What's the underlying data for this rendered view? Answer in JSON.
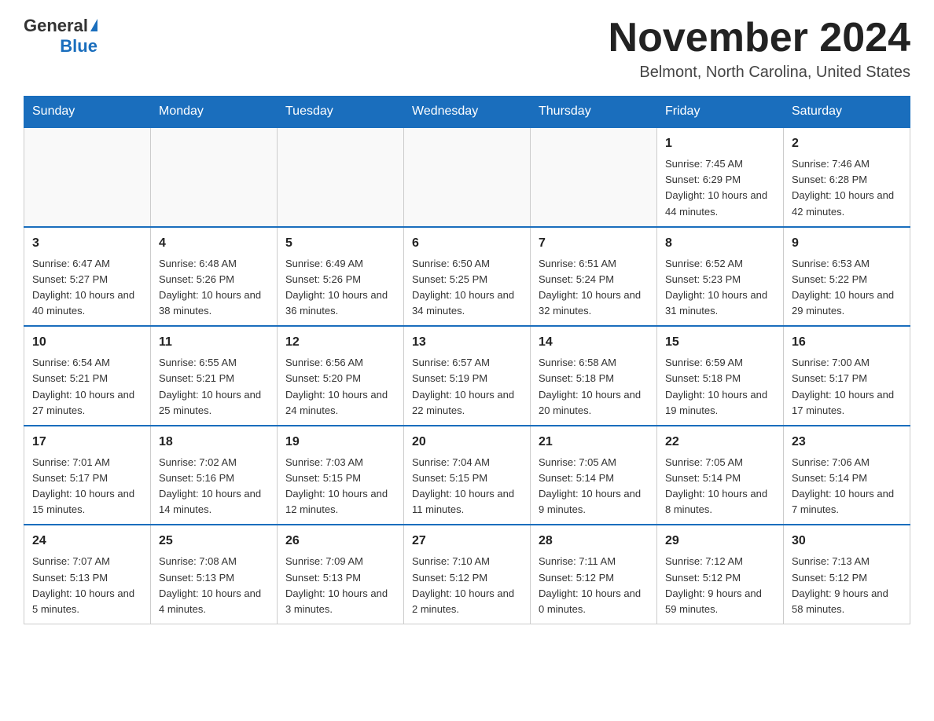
{
  "header": {
    "logo_general": "General",
    "logo_blue": "Blue",
    "month_title": "November 2024",
    "location": "Belmont, North Carolina, United States"
  },
  "days_of_week": [
    "Sunday",
    "Monday",
    "Tuesday",
    "Wednesday",
    "Thursday",
    "Friday",
    "Saturday"
  ],
  "weeks": [
    [
      {
        "day": "",
        "info": ""
      },
      {
        "day": "",
        "info": ""
      },
      {
        "day": "",
        "info": ""
      },
      {
        "day": "",
        "info": ""
      },
      {
        "day": "",
        "info": ""
      },
      {
        "day": "1",
        "info": "Sunrise: 7:45 AM\nSunset: 6:29 PM\nDaylight: 10 hours and 44 minutes."
      },
      {
        "day": "2",
        "info": "Sunrise: 7:46 AM\nSunset: 6:28 PM\nDaylight: 10 hours and 42 minutes."
      }
    ],
    [
      {
        "day": "3",
        "info": "Sunrise: 6:47 AM\nSunset: 5:27 PM\nDaylight: 10 hours and 40 minutes."
      },
      {
        "day": "4",
        "info": "Sunrise: 6:48 AM\nSunset: 5:26 PM\nDaylight: 10 hours and 38 minutes."
      },
      {
        "day": "5",
        "info": "Sunrise: 6:49 AM\nSunset: 5:26 PM\nDaylight: 10 hours and 36 minutes."
      },
      {
        "day": "6",
        "info": "Sunrise: 6:50 AM\nSunset: 5:25 PM\nDaylight: 10 hours and 34 minutes."
      },
      {
        "day": "7",
        "info": "Sunrise: 6:51 AM\nSunset: 5:24 PM\nDaylight: 10 hours and 32 minutes."
      },
      {
        "day": "8",
        "info": "Sunrise: 6:52 AM\nSunset: 5:23 PM\nDaylight: 10 hours and 31 minutes."
      },
      {
        "day": "9",
        "info": "Sunrise: 6:53 AM\nSunset: 5:22 PM\nDaylight: 10 hours and 29 minutes."
      }
    ],
    [
      {
        "day": "10",
        "info": "Sunrise: 6:54 AM\nSunset: 5:21 PM\nDaylight: 10 hours and 27 minutes."
      },
      {
        "day": "11",
        "info": "Sunrise: 6:55 AM\nSunset: 5:21 PM\nDaylight: 10 hours and 25 minutes."
      },
      {
        "day": "12",
        "info": "Sunrise: 6:56 AM\nSunset: 5:20 PM\nDaylight: 10 hours and 24 minutes."
      },
      {
        "day": "13",
        "info": "Sunrise: 6:57 AM\nSunset: 5:19 PM\nDaylight: 10 hours and 22 minutes."
      },
      {
        "day": "14",
        "info": "Sunrise: 6:58 AM\nSunset: 5:18 PM\nDaylight: 10 hours and 20 minutes."
      },
      {
        "day": "15",
        "info": "Sunrise: 6:59 AM\nSunset: 5:18 PM\nDaylight: 10 hours and 19 minutes."
      },
      {
        "day": "16",
        "info": "Sunrise: 7:00 AM\nSunset: 5:17 PM\nDaylight: 10 hours and 17 minutes."
      }
    ],
    [
      {
        "day": "17",
        "info": "Sunrise: 7:01 AM\nSunset: 5:17 PM\nDaylight: 10 hours and 15 minutes."
      },
      {
        "day": "18",
        "info": "Sunrise: 7:02 AM\nSunset: 5:16 PM\nDaylight: 10 hours and 14 minutes."
      },
      {
        "day": "19",
        "info": "Sunrise: 7:03 AM\nSunset: 5:15 PM\nDaylight: 10 hours and 12 minutes."
      },
      {
        "day": "20",
        "info": "Sunrise: 7:04 AM\nSunset: 5:15 PM\nDaylight: 10 hours and 11 minutes."
      },
      {
        "day": "21",
        "info": "Sunrise: 7:05 AM\nSunset: 5:14 PM\nDaylight: 10 hours and 9 minutes."
      },
      {
        "day": "22",
        "info": "Sunrise: 7:05 AM\nSunset: 5:14 PM\nDaylight: 10 hours and 8 minutes."
      },
      {
        "day": "23",
        "info": "Sunrise: 7:06 AM\nSunset: 5:14 PM\nDaylight: 10 hours and 7 minutes."
      }
    ],
    [
      {
        "day": "24",
        "info": "Sunrise: 7:07 AM\nSunset: 5:13 PM\nDaylight: 10 hours and 5 minutes."
      },
      {
        "day": "25",
        "info": "Sunrise: 7:08 AM\nSunset: 5:13 PM\nDaylight: 10 hours and 4 minutes."
      },
      {
        "day": "26",
        "info": "Sunrise: 7:09 AM\nSunset: 5:13 PM\nDaylight: 10 hours and 3 minutes."
      },
      {
        "day": "27",
        "info": "Sunrise: 7:10 AM\nSunset: 5:12 PM\nDaylight: 10 hours and 2 minutes."
      },
      {
        "day": "28",
        "info": "Sunrise: 7:11 AM\nSunset: 5:12 PM\nDaylight: 10 hours and 0 minutes."
      },
      {
        "day": "29",
        "info": "Sunrise: 7:12 AM\nSunset: 5:12 PM\nDaylight: 9 hours and 59 minutes."
      },
      {
        "day": "30",
        "info": "Sunrise: 7:13 AM\nSunset: 5:12 PM\nDaylight: 9 hours and 58 minutes."
      }
    ]
  ]
}
